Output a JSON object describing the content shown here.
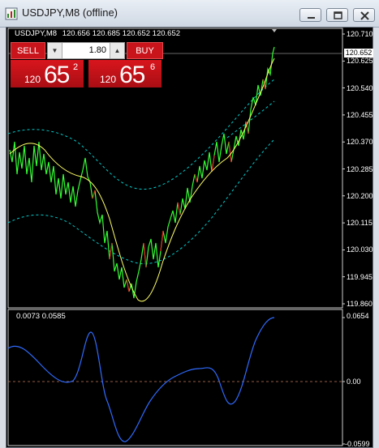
{
  "window": {
    "title": "USDJPY,M8 (offline)"
  },
  "chart": {
    "info_symbol": "USDJPY,M8",
    "info_ohlc": "120.656 120.685 120.652 120.652",
    "price_axis": [
      "120.710",
      "120.625",
      "120.540",
      "120.455",
      "120.370",
      "120.285",
      "120.200",
      "120.115",
      "120.030",
      "119.945",
      "119.860"
    ],
    "current_price": "120.652",
    "osc_label": "0.0073 0.0585",
    "osc_axis_top": "0.0654",
    "osc_axis_zero": "0.00",
    "osc_axis_bottom": "-0.0599",
    "colors": {
      "bars": "#33ff33",
      "ma": "#ffff66",
      "channel": "#00cccc",
      "osc": "#2f6bff",
      "zero_line": "#c87a5a"
    }
  },
  "trade_panel": {
    "sell_label": "SELL",
    "buy_label": "BUY",
    "lot": "1.80",
    "sell_price_prefix": "120",
    "sell_price_big": "65",
    "sell_price_sup": "2",
    "buy_price_prefix": "120",
    "buy_price_big": "65",
    "buy_price_sup": "6"
  }
}
